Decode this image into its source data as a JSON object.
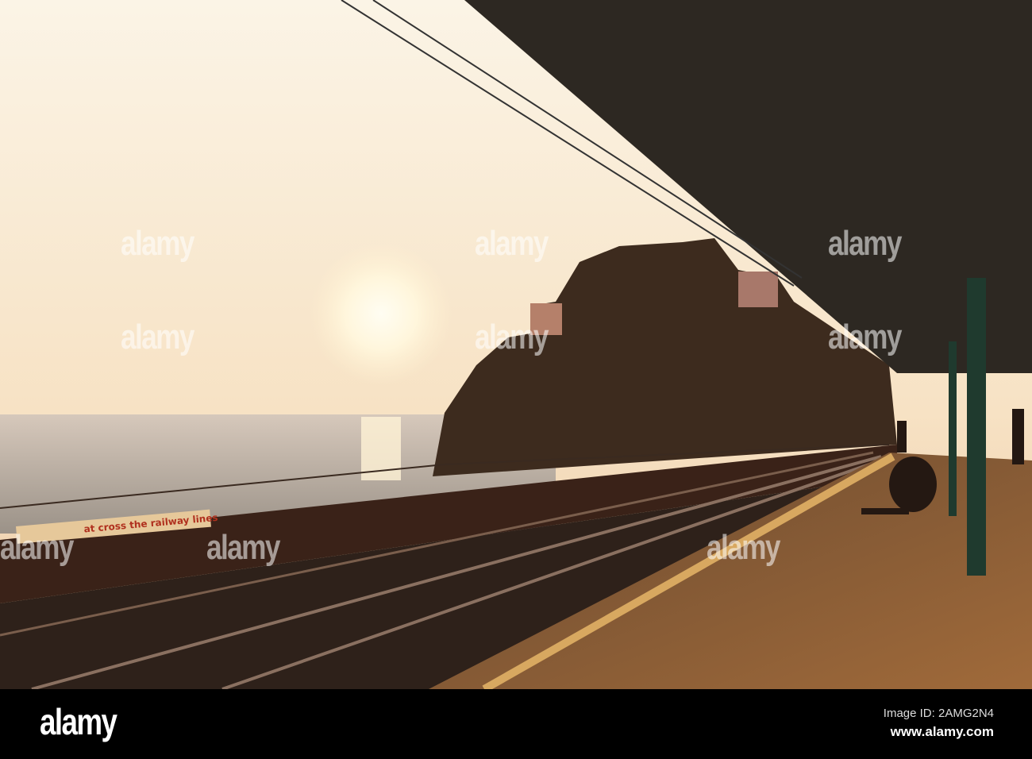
{
  "photo": {
    "sign_text": "at cross the railway lines",
    "colors": {
      "sky_top": "#fbf3e3",
      "sky_bottom": "#f0cfa8",
      "sun": "#fffbe6",
      "sea": "#b9aea2",
      "cliff": "#3d2b1e",
      "roof": "#2b2620",
      "platform": "#8a5a32"
    }
  },
  "watermark": {
    "text": "alamy"
  },
  "footer": {
    "logo": "alamy",
    "image_id": "Image ID: 2AMG2N4",
    "url": "www.alamy.com"
  }
}
